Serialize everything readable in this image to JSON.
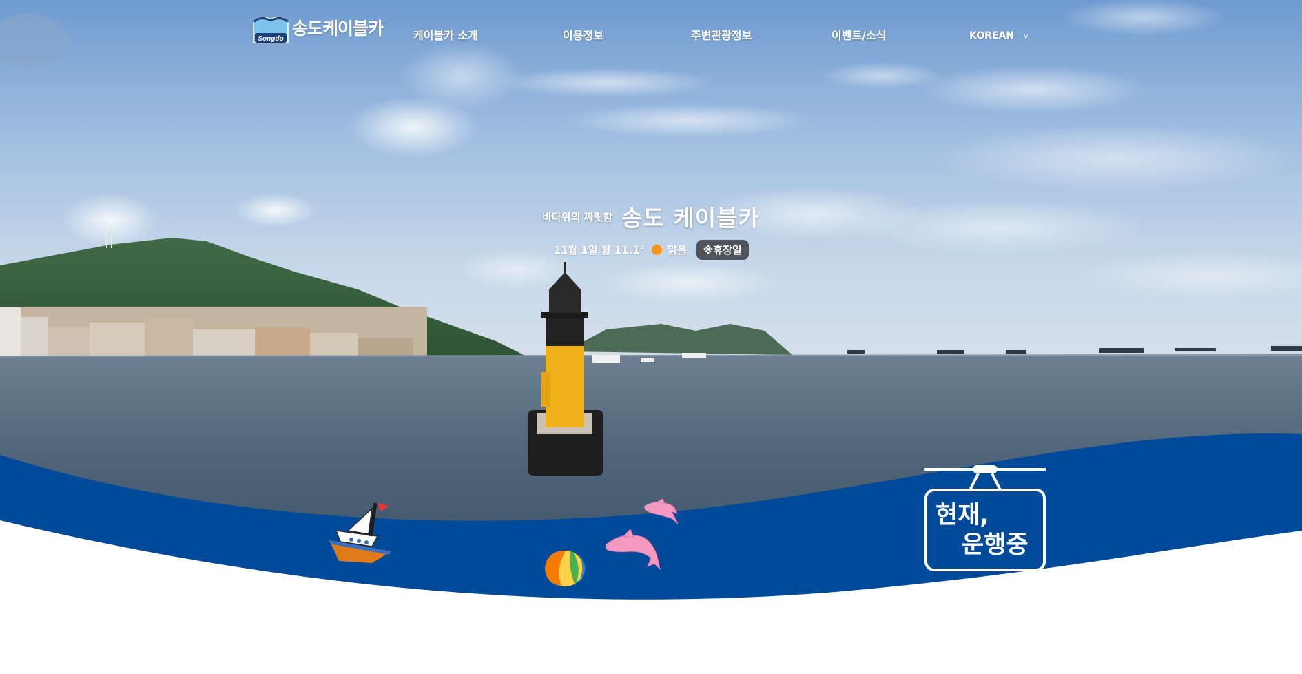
{
  "header": {
    "logo_text": "송도케이블카",
    "logo_mark_text": "Songdo",
    "nav": [
      {
        "label": "케이블카 소개"
      },
      {
        "label": "이용정보"
      },
      {
        "label": "주변관광정보"
      },
      {
        "label": "이벤트/소식"
      }
    ],
    "language": "KOREAN",
    "language_chevron": "v"
  },
  "hero": {
    "tagline_sub": "바다위의 짜릿함",
    "tagline_main": "송도 케이블카",
    "weather": {
      "date": "11월 1일 월 11.1°",
      "icon": "sun-icon",
      "condition": "맑음",
      "holiday_badge": "※휴장일"
    },
    "status": {
      "line1": "현재,",
      "line2": "운행중"
    }
  },
  "colors": {
    "wave_blue": "#004a99",
    "sun_orange": "#f7931e",
    "dolphin_pink": "#f49ac1"
  }
}
